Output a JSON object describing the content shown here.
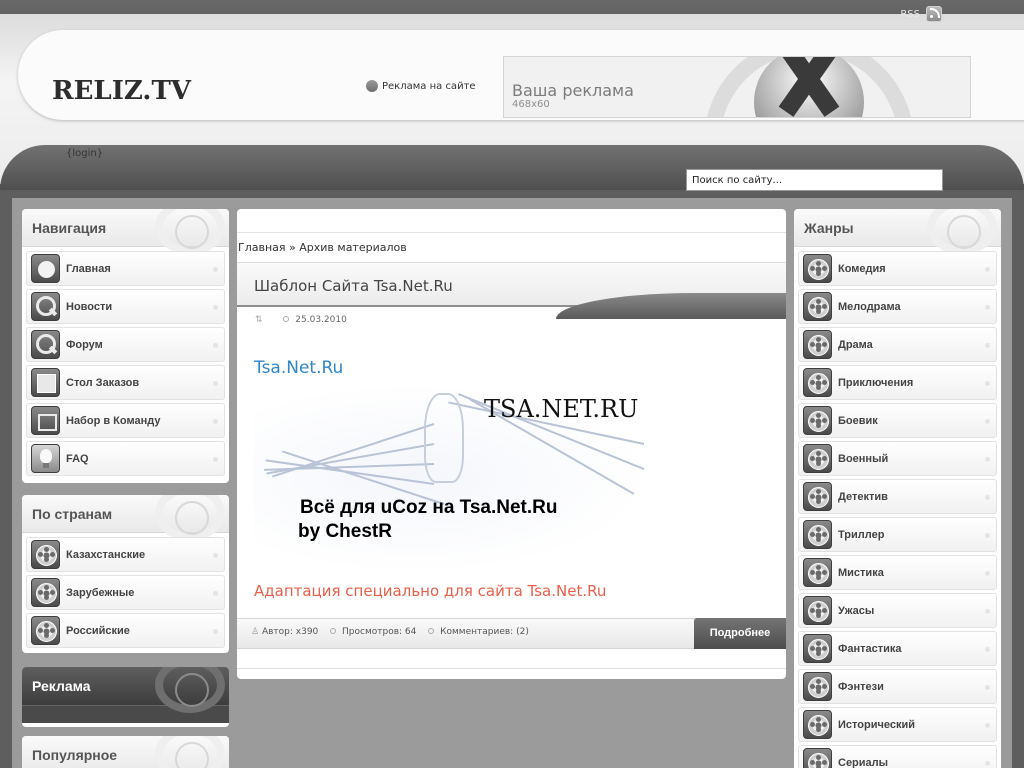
{
  "header": {
    "rss_label": "RSS",
    "logo": "RELIZ.TV",
    "ad_link": "Реклама на сайте",
    "banner_title": "Ваша реклама",
    "banner_size": "468x60",
    "login": "{login}",
    "search_value": "Поиск по сайту..."
  },
  "left": {
    "nav_title": "Навигация",
    "nav_items": [
      {
        "label": "Главная",
        "icon": "gamepad-icon"
      },
      {
        "label": "Новости",
        "icon": "magnifier-icon"
      },
      {
        "label": "Форум",
        "icon": "magnifier-icon"
      },
      {
        "label": "Стол Заказов",
        "icon": "map-icon"
      },
      {
        "label": "Набор в Команду",
        "icon": "window-icon"
      },
      {
        "label": "FAQ",
        "icon": "lightbulb-icon"
      }
    ],
    "countries_title": "По странам",
    "countries": [
      {
        "label": "Казахстанские"
      },
      {
        "label": "Зарубежные"
      },
      {
        "label": "Российские"
      }
    ],
    "ads_title": "Реклама",
    "popular_title": "Популярное"
  },
  "center": {
    "breadcrumb_home": "Главная",
    "breadcrumb_sep": " » ",
    "breadcrumb_current": "Архив материалов",
    "post_title": "Шаблон Сайта Tsa.Net.Ru",
    "post_date": "25.03.2010",
    "post_link": "Tsa.Net.Ru",
    "image_heading": "TSA.NET.RU",
    "image_line1": "Всё для uCoz на Tsa.Net.Ru",
    "image_line2": "by  ChestR",
    "adaptation": "Адаптация специально для сайта  Tsa.Net.Ru",
    "author": "Автор: x390",
    "views": "Просмотров: 64",
    "comments": "Комментариев: (2)",
    "more_label": "Подробнее"
  },
  "right": {
    "genres_title": "Жанры",
    "genres": [
      {
        "label": "Комедия"
      },
      {
        "label": "Мелодрама"
      },
      {
        "label": "Драма"
      },
      {
        "label": "Приключения"
      },
      {
        "label": "Боевик"
      },
      {
        "label": "Военный"
      },
      {
        "label": "Детектив"
      },
      {
        "label": "Триллер"
      },
      {
        "label": "Мистика"
      },
      {
        "label": "Ужасы"
      },
      {
        "label": "Фантастика"
      },
      {
        "label": "Фэнтези"
      },
      {
        "label": "Исторический"
      },
      {
        "label": "Сериалы"
      }
    ]
  }
}
